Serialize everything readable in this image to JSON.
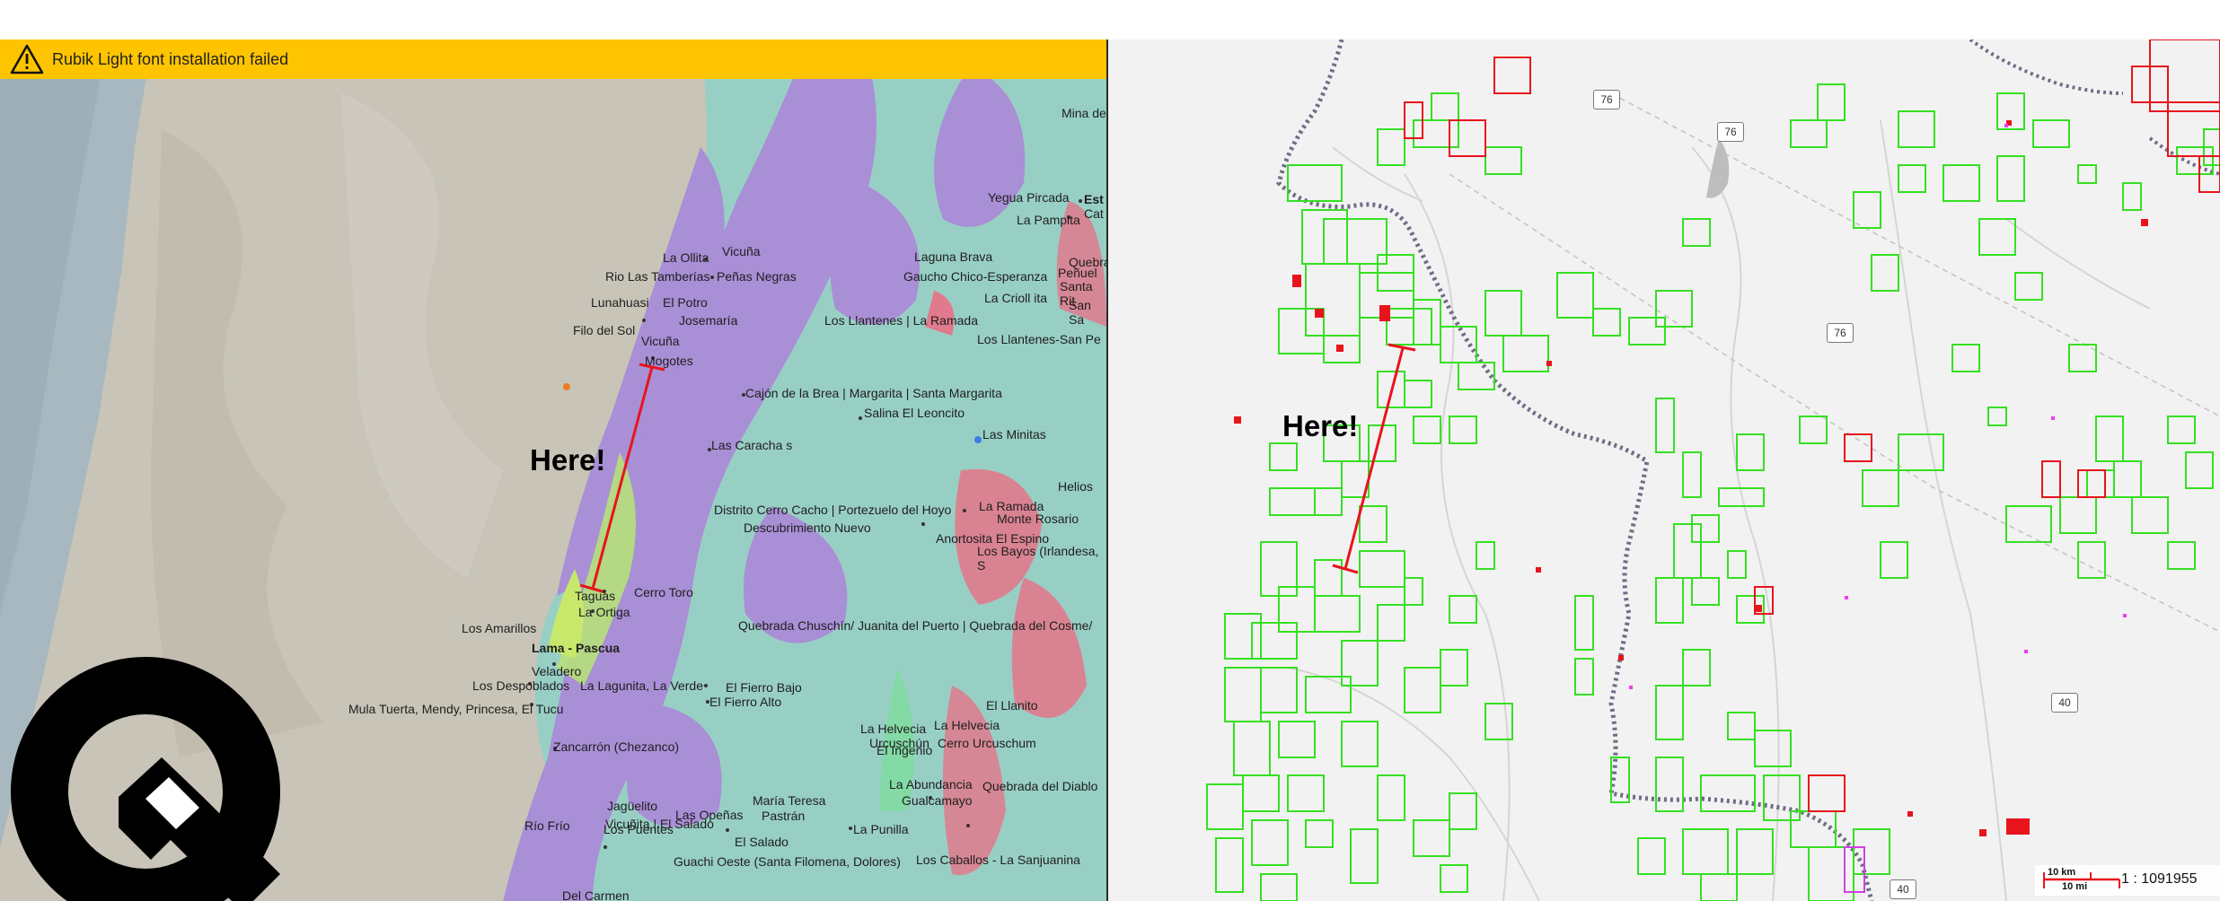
{
  "banner": {
    "icon": "warning-triangle-icon",
    "text": "Rubik Light font installation failed",
    "color": "#fec400"
  },
  "left_map": {
    "annotation": "Here!",
    "place_labels": [
      "Mina de",
      "Yegua Pircada",
      "Est",
      "Cat",
      "La Pampita",
      "La Ollita",
      "Vicuña",
      "Rio Las Tamberías",
      "Peñas Negras",
      "Laguna Brava",
      "Gaucho Chico-Esperanza",
      "Quebra",
      "Peñuel",
      "Santa Rit",
      "La Crioll ita",
      "San Sa",
      "Lunahuasi",
      "El Potro",
      "Josemaría",
      "Los Llantenes | La Ramada",
      "Los Llantenes-San Pe",
      "Filo del Sol",
      "Vicuña",
      "Mogotes",
      "Cajón de la Brea | Margarita | Santa Margarita",
      "Salina El Leoncito",
      "Las Minitas",
      "Las Caracha s",
      "Helios",
      "Distrito Cerro Cacho | Portezuelo del Hoyo",
      "La Ramada",
      "Monte Rosario",
      "Descubrimiento Nuevo",
      "Anortosita El Espino",
      "Los Bayos (Irlandesa, S",
      "Cerro Toro",
      "Taguas",
      "La Ortiga",
      "Los Amarillos",
      "Quebrada Chuschín/ Juanita del Puerto | Quebrada del Cosme/",
      "Lama - Pascua",
      "Veladero",
      "Los Despoblados",
      "La Lagunita, La Verde",
      "El Fierro Bajo",
      "El Fierro Alto",
      "Mula Tuerta, Mendy, Princesa, El Tucu",
      "El Llanito",
      "La Helvecia",
      "La Helvecia",
      "Urcuschún",
      "Cerro Urcuschum",
      "El Ingenio",
      "Zancarrón (Chezanco)",
      "La Abundancia",
      "Quebrada del Diablo",
      "Gualcamayo",
      "María Teresa",
      "Pastrán",
      "Jagüelito",
      "Las Opeñas",
      "Río Frío",
      "Los Puentes",
      "Vicuñita | El Salado",
      "El Salado",
      "La Punilla",
      "Guachi Oeste (Santa Filomena, Dolores)",
      "Los Caballos - La Sanjuanina",
      "Del Carmen"
    ],
    "logo": "q-logo"
  },
  "right_map": {
    "annotation": "Here!",
    "route_shields": [
      "76",
      "76",
      "76",
      "40",
      "40"
    ],
    "scale_bar": {
      "km_label": "10 km",
      "mi_label": "10 mi"
    },
    "scale_ratio": "1 : 1091955"
  }
}
